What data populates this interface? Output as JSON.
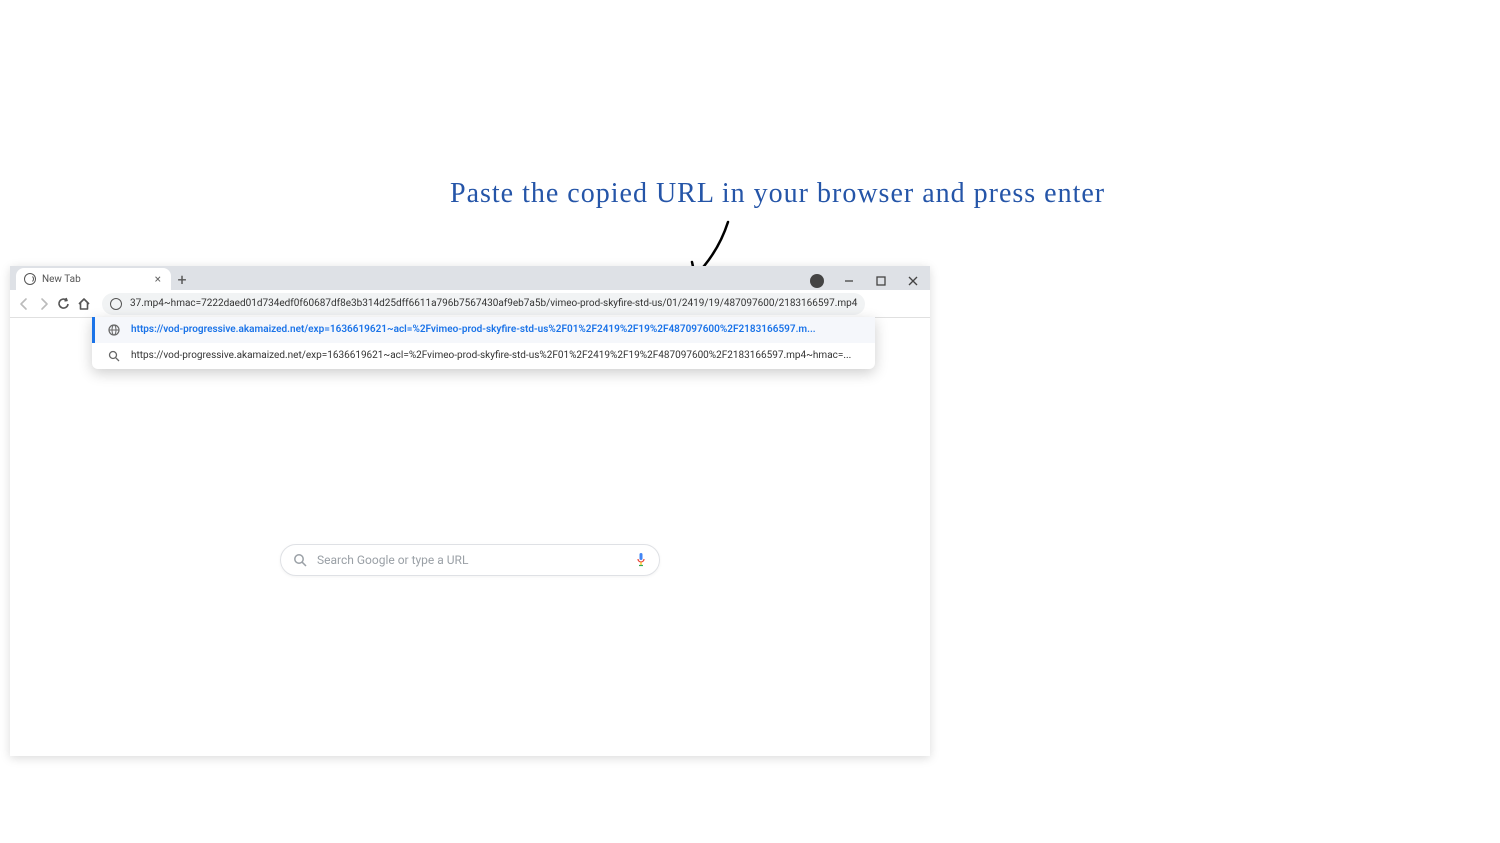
{
  "annotation": {
    "text": "Paste the copied URL in your browser and press enter"
  },
  "browser": {
    "tab": {
      "title": "New Tab"
    },
    "window_controls": {
      "account": "account",
      "minimize": "minimize",
      "maximize": "maximize",
      "close": "close"
    },
    "omnibox": {
      "value": "37.mp4~hmac=7222daed01d734edf0f60687df8e3b314d25dff6611a796b7567430af9eb7a5b/vimeo-prod-skyfire-std-us/01/2419/19/487097600/2183166597.mp4"
    },
    "suggestions": [
      {
        "type": "url",
        "text": "https://vod-progressive.akamaized.net/exp=1636619621~acl=%2Fvimeo-prod-skyfire-std-us%2F01%2F2419%2F19%2F487097600%2F2183166597.m...",
        "selected": true
      },
      {
        "type": "search",
        "text": "https://vod-progressive.akamaized.net/exp=1636619621~acl=%2Fvimeo-prod-skyfire-std-us%2F01%2F2419%2F19%2F487097600%2F2183166597.mp4~hmac=...",
        "selected": false
      }
    ],
    "google_search": {
      "placeholder": "Search Google or type a URL"
    }
  }
}
